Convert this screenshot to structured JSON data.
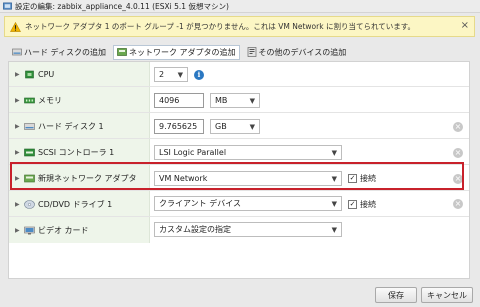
{
  "window": {
    "title": "設定の編集: zabbix_appliance_4.0.11 (ESXi 5.1 仮想マシン)"
  },
  "warning": {
    "message": "ネットワーク アダプタ 1 のポート グループ -1 が見つかりません。これは VM Network に割り当てられています。",
    "close_glyph": "×"
  },
  "toolbar": {
    "add_disk": "ハード ディスクの追加",
    "add_nic": "ネットワーク アダプタの追加",
    "add_other": "その他のデバイスの追加"
  },
  "rows": [
    {
      "label": "CPU",
      "value": "2"
    },
    {
      "label": "メモリ",
      "value": "4096",
      "unit": "MB"
    },
    {
      "label": "ハード ディスク 1",
      "value": "9.765625",
      "unit": "GB"
    },
    {
      "label": "SCSI コントローラ 1",
      "value": "LSI Logic Parallel"
    },
    {
      "label": "新規ネットワーク アダプタ",
      "value": "VM Network",
      "connect_label": "接続"
    },
    {
      "label": "CD/DVD ドライブ 1",
      "value": "クライアント デバイス",
      "connect_label": "接続"
    },
    {
      "label": "ビデオ カード",
      "value": "カスタム設定の指定"
    }
  ],
  "glyphs": {
    "expand": "▶",
    "dropdown": "▼",
    "remove": "×",
    "check": "✓",
    "info": "i"
  },
  "footer": {
    "save": "保存",
    "cancel": "キャンセル"
  },
  "colors": {
    "highlight": "#c8212b",
    "warning_bg": "#fcf6c4",
    "label_cell_bg": "#eef5ea",
    "info": "#2b78c2"
  }
}
